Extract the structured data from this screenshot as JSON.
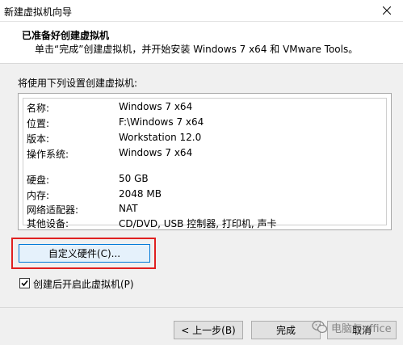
{
  "window": {
    "title": "新建虚拟机向导"
  },
  "header": {
    "title": "已准备好创建虚拟机",
    "subtitle": "单击“完成”创建虚拟机，并开始安装 Windows 7 x64 和 VMware Tools。"
  },
  "intro_label": "将使用下列设置创建虚拟机:",
  "summary": [
    {
      "key": "名称:",
      "value": "Windows 7 x64"
    },
    {
      "key": "位置:",
      "value": "F:\\Windows 7 x64"
    },
    {
      "key": "版本:",
      "value": "Workstation 12.0"
    },
    {
      "key": "操作系统:",
      "value": "Windows 7 x64"
    },
    {
      "key": "硬盘:",
      "value": "50 GB"
    },
    {
      "key": "内存:",
      "value": "2048 MB"
    },
    {
      "key": "网络适配器:",
      "value": "NAT"
    },
    {
      "key": "其他设备:",
      "value": "CD/DVD, USB 控制器, 打印机, 声卡"
    }
  ],
  "customize_button": "自定义硬件(C)...",
  "power_on_checkbox": {
    "label": "创建后开启此虚拟机(P)",
    "checked": true
  },
  "footer": {
    "prev": "< 上一步(B)",
    "finish": "完成",
    "cancel": "取消"
  },
  "watermark": "电脑与office",
  "colors": {
    "highlight": "#e02020",
    "focus": "#0078d7"
  }
}
